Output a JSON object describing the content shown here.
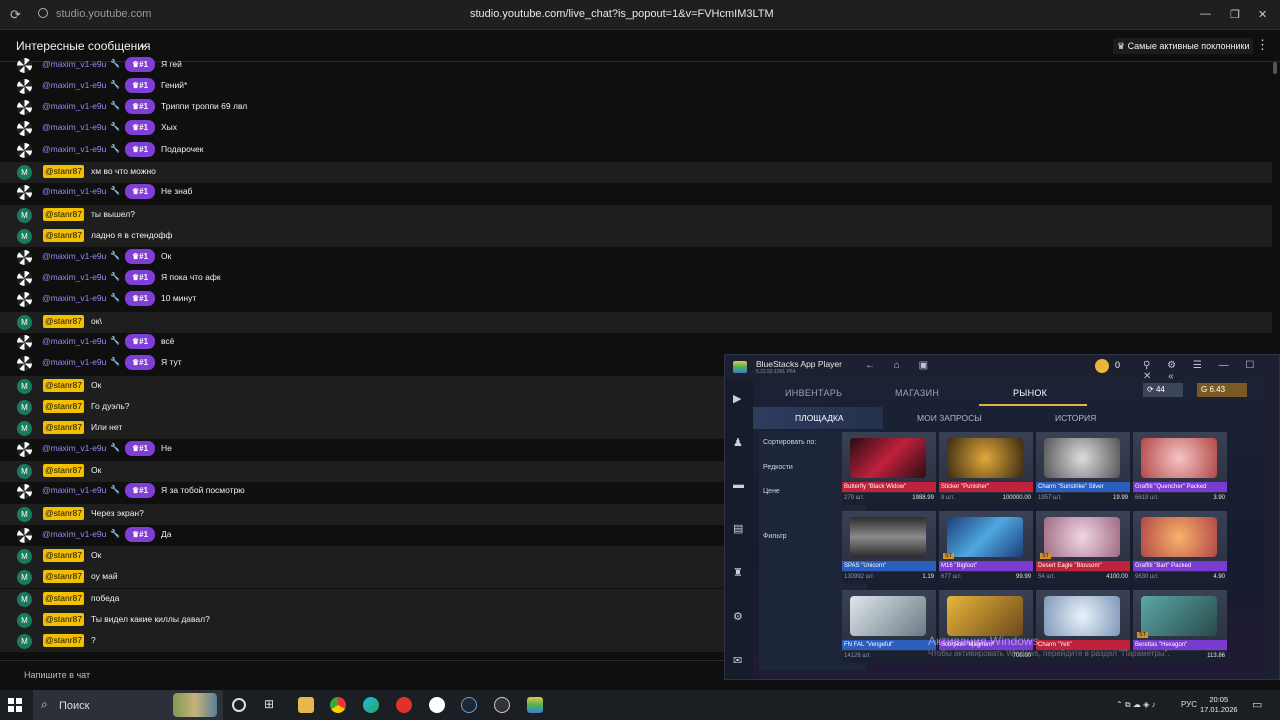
{
  "browser": {
    "host": "studio.youtube.com",
    "url": "studio.youtube.com/live_chat?is_popout=1&v=FVHcmIM3LTM"
  },
  "chat": {
    "title": "Интересные сообщения",
    "top_fans_label": "Самые активные поклонники",
    "input_placeholder": "Напишите в чат",
    "messages": [
      {
        "author": "@maxim_v1-e9u",
        "badge": "#1",
        "text": "Я гей",
        "owner": false
      },
      {
        "author": "@maxim_v1-e9u",
        "badge": "#1",
        "text": "Гений*",
        "owner": false
      },
      {
        "author": "@maxim_v1-e9u",
        "badge": "#1",
        "text": "Триппи троппи 69 лвл",
        "owner": false
      },
      {
        "author": "@maxim_v1-e9u",
        "badge": "#1",
        "text": "Хых",
        "owner": false
      },
      {
        "author": "@maxim_v1-e9u",
        "badge": "#1",
        "text": "Подарочек",
        "owner": false
      },
      {
        "author": "@stanr87",
        "text": "хм во что можно",
        "owner": true
      },
      {
        "author": "@maxim_v1-e9u",
        "badge": "#1",
        "text": "Не знаб",
        "owner": false
      },
      {
        "author": "@stanr87",
        "text": "ты вышел?",
        "owner": true
      },
      {
        "author": "@stanr87",
        "text": "ладно я в стендофф",
        "owner": true
      },
      {
        "author": "@maxim_v1-e9u",
        "badge": "#1",
        "text": "Ок",
        "owner": false
      },
      {
        "author": "@maxim_v1-e9u",
        "badge": "#1",
        "text": "Я пока что афк",
        "owner": false
      },
      {
        "author": "@maxim_v1-e9u",
        "badge": "#1",
        "text": "10 минут",
        "owner": false
      },
      {
        "author": "@stanr87",
        "text": "ок\\",
        "owner": true
      },
      {
        "author": "@maxim_v1-e9u",
        "badge": "#1",
        "text": "всё",
        "owner": false
      },
      {
        "author": "@maxim_v1-e9u",
        "badge": "#1",
        "text": "Я тут",
        "owner": false
      },
      {
        "author": "@stanr87",
        "text": "Ок",
        "owner": true
      },
      {
        "author": "@stanr87",
        "text": "Го дуэль?",
        "owner": true
      },
      {
        "author": "@stanr87",
        "text": "Или нет",
        "owner": true
      },
      {
        "author": "@maxim_v1-e9u",
        "badge": "#1",
        "text": "Не",
        "owner": false
      },
      {
        "author": "@stanr87",
        "text": "Ок",
        "owner": true
      },
      {
        "author": "@maxim_v1-e9u",
        "badge": "#1",
        "text": "Я за тобой посмотрю",
        "owner": false
      },
      {
        "author": "@stanr87",
        "text": "Через экран?",
        "owner": true
      },
      {
        "author": "@maxim_v1-e9u",
        "badge": "#1",
        "text": "Да",
        "owner": false
      },
      {
        "author": "@stanr87",
        "text": "Ок",
        "owner": true
      },
      {
        "author": "@stanr87",
        "text": "оу май",
        "owner": true
      },
      {
        "author": "@stanr87",
        "text": "победа",
        "owner": true
      },
      {
        "author": "@stanr87",
        "text": "Ты видел какие киллы давал?",
        "owner": true
      },
      {
        "author": "@stanr87",
        "text": "?",
        "owner": true
      }
    ]
  },
  "bluestacks": {
    "title": "BlueStacks App Player",
    "version": "5.22.50.1001 P64",
    "coins": "0",
    "game": {
      "tabs": [
        "ИНВЕНТАРЬ",
        "МАГАЗИН",
        "РЫНОК"
      ],
      "subtabs": [
        "ПЛОЩАДКА",
        "МОИ ЗАПРОСЫ",
        "ИСТОРИЯ"
      ],
      "balance_silver": "44",
      "balance_gold": "6.43",
      "sort_label": "Сортировать по:",
      "sort_options": [
        "Редкости",
        "Цене"
      ],
      "filter_label": "Фильтр",
      "items": [
        {
          "name": "Butterfly \"Black Widow\"",
          "qty": "279 шт.",
          "price": "1988.99",
          "color": "#c0213b",
          "img": "linear-gradient(135deg,#2a0d14,#c0213b 50%,#2a0d14)"
        },
        {
          "name": "Sticker \"Punisher\"",
          "qty": "9 шт.",
          "price": "100000.00",
          "color": "#c0213b",
          "img": "radial-gradient(circle,#e0a83a,#3a2a12)"
        },
        {
          "name": "Charm \"Sunstrike\" Silver",
          "qty": "1957 шт.",
          "price": "19.99",
          "color": "#2a5fbf",
          "img": "radial-gradient(circle,#dddddd,#555)"
        },
        {
          "name": "Graffiti \"Quencher\" Packed",
          "qty": "6619 шт.",
          "price": "3.90",
          "color": "#7a3bd1",
          "img": "radial-gradient(circle,#f5c4c4,#b24848)"
        },
        {
          "name": "SPAS \"Unicorn\"",
          "qty": "130992 шт.",
          "price": "1.19",
          "color": "#2a5fbf",
          "img": "linear-gradient(180deg,#2c2c2c,#8a8a8a 50%,#2c2c2c)"
        },
        {
          "name": "M16 \"Bigfoot\"",
          "qty": "677 шт.",
          "price": "99.99",
          "color": "#7a3bd1",
          "img": "linear-gradient(135deg,#1b3e7a,#4fa8e0 50%,#1b3e7a)",
          "st": "ST"
        },
        {
          "name": "Desert Eagle \"Blossom\"",
          "qty": "54 шт.",
          "price": "4100.00",
          "color": "#c0213b",
          "img": "radial-gradient(circle,#f1d6e4,#a06a82)",
          "st": "ST"
        },
        {
          "name": "Graffiti \"Bart\" Packed",
          "qty": "9630 шт.",
          "price": "4.90",
          "color": "#7a3bd1",
          "img": "radial-gradient(circle,#f7b36a,#b24848)"
        },
        {
          "name": "FN FAL \"Vengeful\"",
          "qty": "14126 шт.",
          "price": "",
          "color": "#2a5fbf",
          "img": "linear-gradient(135deg,#dfe7ec,#6a7a84)"
        },
        {
          "name": "Scorpion \"Magnum\"",
          "qty": "",
          "price": "700.00",
          "color": "#7a3bd1",
          "img": "linear-gradient(135deg,#e9b53a,#6a4a1a)"
        },
        {
          "name": "Charm \"Yeti\"",
          "qty": "",
          "price": "",
          "color": "#c0213b",
          "img": "radial-gradient(circle,#eaf2fb,#7f98b8)"
        },
        {
          "name": "Berettas \"Hexagon\"",
          "qty": "",
          "price": "113.86",
          "color": "#7a3bd1",
          "img": "linear-gradient(135deg,#5aa8a8,#2a4a4a)",
          "st": "ST"
        }
      ],
      "watermark": "Активация Windows",
      "watermark2": "Чтобы активировать Windows, перейдите в раздел \"Параметры\"."
    }
  },
  "taskbar": {
    "search_label": "Поиск",
    "lang": "РУС",
    "time": "20:05",
    "date": "17.01.2026"
  }
}
